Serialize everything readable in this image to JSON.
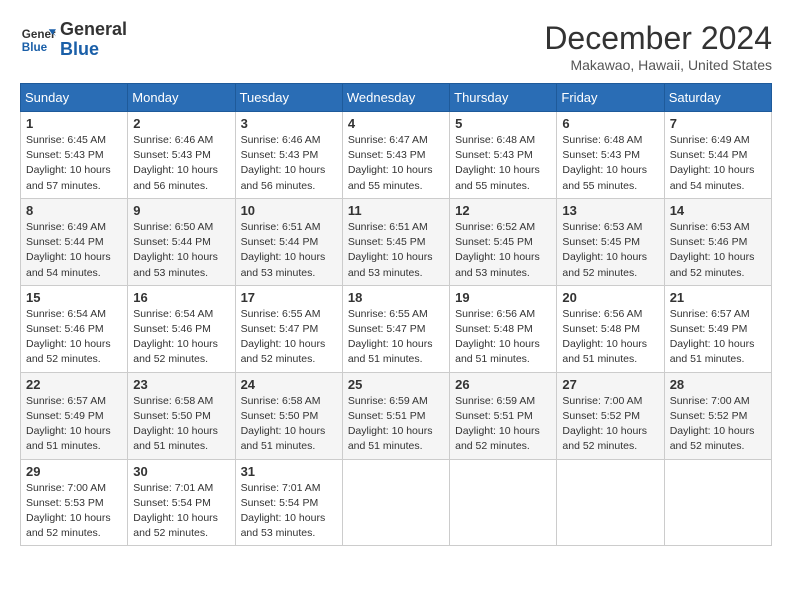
{
  "header": {
    "logo_line1": "General",
    "logo_line2": "Blue",
    "month": "December 2024",
    "location": "Makawao, Hawaii, United States"
  },
  "weekdays": [
    "Sunday",
    "Monday",
    "Tuesday",
    "Wednesday",
    "Thursday",
    "Friday",
    "Saturday"
  ],
  "weeks": [
    [
      {
        "day": "1",
        "sunrise": "6:45 AM",
        "sunset": "5:43 PM",
        "daylight": "10 hours and 57 minutes."
      },
      {
        "day": "2",
        "sunrise": "6:46 AM",
        "sunset": "5:43 PM",
        "daylight": "10 hours and 56 minutes."
      },
      {
        "day": "3",
        "sunrise": "6:46 AM",
        "sunset": "5:43 PM",
        "daylight": "10 hours and 56 minutes."
      },
      {
        "day": "4",
        "sunrise": "6:47 AM",
        "sunset": "5:43 PM",
        "daylight": "10 hours and 55 minutes."
      },
      {
        "day": "5",
        "sunrise": "6:48 AM",
        "sunset": "5:43 PM",
        "daylight": "10 hours and 55 minutes."
      },
      {
        "day": "6",
        "sunrise": "6:48 AM",
        "sunset": "5:43 PM",
        "daylight": "10 hours and 55 minutes."
      },
      {
        "day": "7",
        "sunrise": "6:49 AM",
        "sunset": "5:44 PM",
        "daylight": "10 hours and 54 minutes."
      }
    ],
    [
      {
        "day": "8",
        "sunrise": "6:49 AM",
        "sunset": "5:44 PM",
        "daylight": "10 hours and 54 minutes."
      },
      {
        "day": "9",
        "sunrise": "6:50 AM",
        "sunset": "5:44 PM",
        "daylight": "10 hours and 53 minutes."
      },
      {
        "day": "10",
        "sunrise": "6:51 AM",
        "sunset": "5:44 PM",
        "daylight": "10 hours and 53 minutes."
      },
      {
        "day": "11",
        "sunrise": "6:51 AM",
        "sunset": "5:45 PM",
        "daylight": "10 hours and 53 minutes."
      },
      {
        "day": "12",
        "sunrise": "6:52 AM",
        "sunset": "5:45 PM",
        "daylight": "10 hours and 53 minutes."
      },
      {
        "day": "13",
        "sunrise": "6:53 AM",
        "sunset": "5:45 PM",
        "daylight": "10 hours and 52 minutes."
      },
      {
        "day": "14",
        "sunrise": "6:53 AM",
        "sunset": "5:46 PM",
        "daylight": "10 hours and 52 minutes."
      }
    ],
    [
      {
        "day": "15",
        "sunrise": "6:54 AM",
        "sunset": "5:46 PM",
        "daylight": "10 hours and 52 minutes."
      },
      {
        "day": "16",
        "sunrise": "6:54 AM",
        "sunset": "5:46 PM",
        "daylight": "10 hours and 52 minutes."
      },
      {
        "day": "17",
        "sunrise": "6:55 AM",
        "sunset": "5:47 PM",
        "daylight": "10 hours and 52 minutes."
      },
      {
        "day": "18",
        "sunrise": "6:55 AM",
        "sunset": "5:47 PM",
        "daylight": "10 hours and 51 minutes."
      },
      {
        "day": "19",
        "sunrise": "6:56 AM",
        "sunset": "5:48 PM",
        "daylight": "10 hours and 51 minutes."
      },
      {
        "day": "20",
        "sunrise": "6:56 AM",
        "sunset": "5:48 PM",
        "daylight": "10 hours and 51 minutes."
      },
      {
        "day": "21",
        "sunrise": "6:57 AM",
        "sunset": "5:49 PM",
        "daylight": "10 hours and 51 minutes."
      }
    ],
    [
      {
        "day": "22",
        "sunrise": "6:57 AM",
        "sunset": "5:49 PM",
        "daylight": "10 hours and 51 minutes."
      },
      {
        "day": "23",
        "sunrise": "6:58 AM",
        "sunset": "5:50 PM",
        "daylight": "10 hours and 51 minutes."
      },
      {
        "day": "24",
        "sunrise": "6:58 AM",
        "sunset": "5:50 PM",
        "daylight": "10 hours and 51 minutes."
      },
      {
        "day": "25",
        "sunrise": "6:59 AM",
        "sunset": "5:51 PM",
        "daylight": "10 hours and 51 minutes."
      },
      {
        "day": "26",
        "sunrise": "6:59 AM",
        "sunset": "5:51 PM",
        "daylight": "10 hours and 52 minutes."
      },
      {
        "day": "27",
        "sunrise": "7:00 AM",
        "sunset": "5:52 PM",
        "daylight": "10 hours and 52 minutes."
      },
      {
        "day": "28",
        "sunrise": "7:00 AM",
        "sunset": "5:52 PM",
        "daylight": "10 hours and 52 minutes."
      }
    ],
    [
      {
        "day": "29",
        "sunrise": "7:00 AM",
        "sunset": "5:53 PM",
        "daylight": "10 hours and 52 minutes."
      },
      {
        "day": "30",
        "sunrise": "7:01 AM",
        "sunset": "5:54 PM",
        "daylight": "10 hours and 52 minutes."
      },
      {
        "day": "31",
        "sunrise": "7:01 AM",
        "sunset": "5:54 PM",
        "daylight": "10 hours and 53 minutes."
      },
      null,
      null,
      null,
      null
    ]
  ]
}
